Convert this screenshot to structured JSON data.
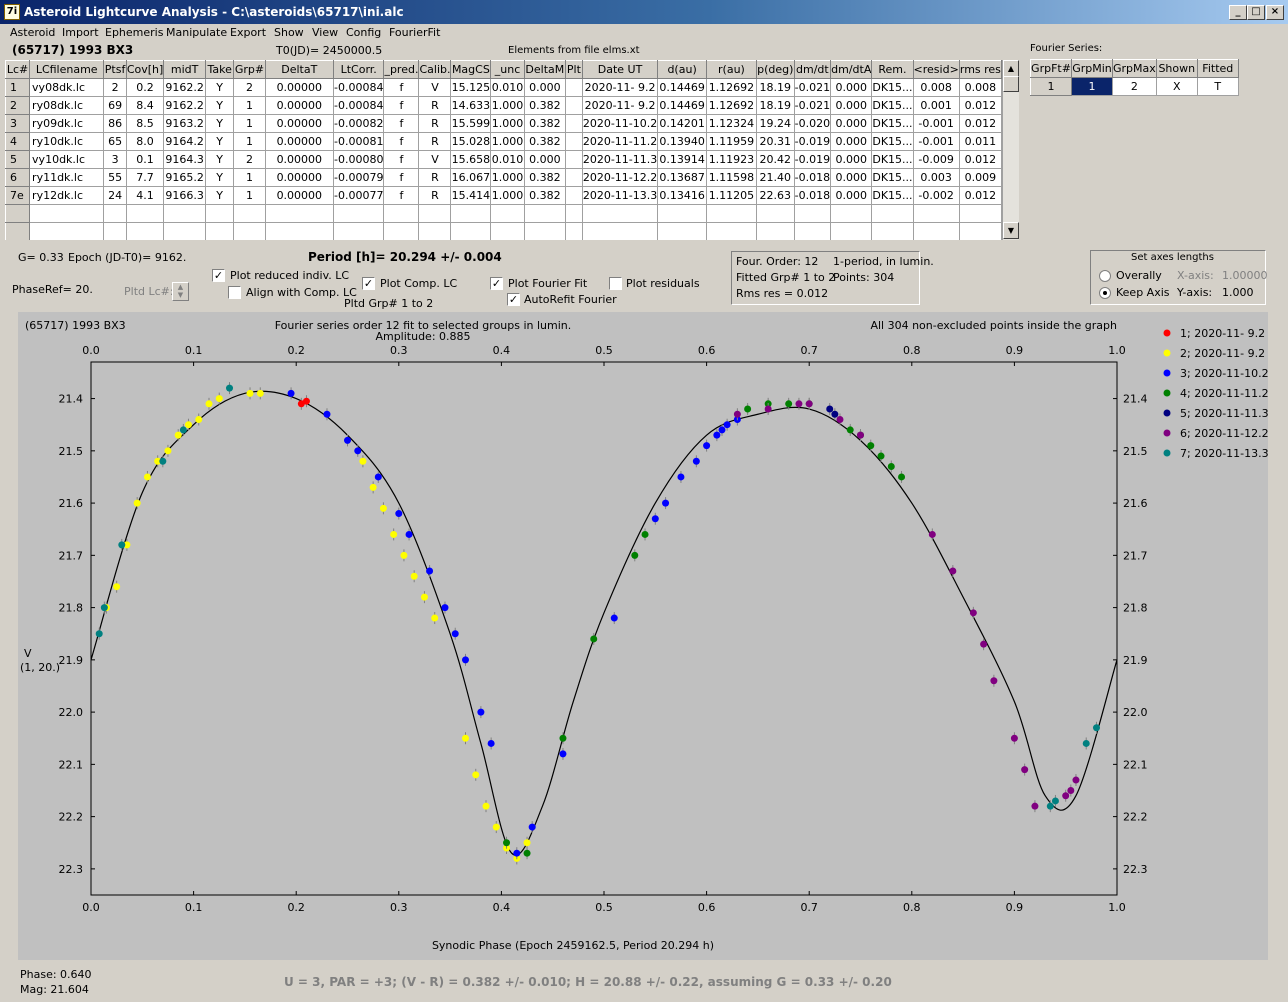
{
  "window": {
    "title": "Asteroid Lightcurve Analysis - C:\\asteroids\\65717\\ini.alc",
    "app_icon_label": "7i"
  },
  "menu": [
    "Asteroid",
    "Import",
    "Ephemeris",
    "Manipulate",
    "Export",
    "Show",
    "View",
    "Config",
    "FourierFit"
  ],
  "header": {
    "asteroid": "(65717) 1993 BX3",
    "t0": "T0(JD)= 2450000.5",
    "elements": "Elements from file elms.xt",
    "fourier_series_label": "Fourier Series:"
  },
  "table": {
    "columns": [
      "Lc#",
      "LCfilename",
      "Ptsf",
      "Cov[h]",
      "midT",
      "Take",
      "Grp#",
      "DeltaT",
      "LtCorr.",
      "_pred.",
      "Calib.",
      "MagCS",
      "_unc",
      "DeltaM",
      "Plt",
      "Date UT",
      "d(au)",
      "r(au)",
      "p(deg)",
      "dm/dt",
      "dm/dtA",
      "Rem.",
      "<resid>",
      "rms res"
    ],
    "rows": [
      [
        "1",
        "vy08dk.lc",
        "2",
        "0.2",
        "9162.2",
        "Y",
        "2",
        "0.00000",
        "-0.00084",
        "f",
        "V",
        "15.125",
        "0.010",
        "0.000",
        "",
        "2020-11- 9.2",
        "0.14469",
        "1.12692",
        "18.19",
        "-0.021",
        "0.000",
        "DK15...",
        "0.008",
        "0.008"
      ],
      [
        "2",
        "ry08dk.lc",
        "69",
        "8.4",
        "9162.2",
        "Y",
        "1",
        "0.00000",
        "-0.00084",
        "f",
        "R",
        "14.633",
        "1.000",
        "0.382",
        "",
        "2020-11- 9.2",
        "0.14469",
        "1.12692",
        "18.19",
        "-0.021",
        "0.000",
        "DK15...",
        "0.001",
        "0.012"
      ],
      [
        "3",
        "ry09dk.lc",
        "86",
        "8.5",
        "9163.2",
        "Y",
        "1",
        "0.00000",
        "-0.00082",
        "f",
        "R",
        "15.599",
        "1.000",
        "0.382",
        "",
        "2020-11-10.2",
        "0.14201",
        "1.12324",
        "19.24",
        "-0.020",
        "0.000",
        "DK15...",
        "-0.001",
        "0.012"
      ],
      [
        "4",
        "ry10dk.lc",
        "65",
        "8.0",
        "9164.2",
        "Y",
        "1",
        "0.00000",
        "-0.00081",
        "f",
        "R",
        "15.028",
        "1.000",
        "0.382",
        "",
        "2020-11-11.2",
        "0.13940",
        "1.11959",
        "20.31",
        "-0.019",
        "0.000",
        "DK15...",
        "-0.001",
        "0.011"
      ],
      [
        "5",
        "vy10dk.lc",
        "3",
        "0.1",
        "9164.3",
        "Y",
        "2",
        "0.00000",
        "-0.00080",
        "f",
        "V",
        "15.658",
        "0.010",
        "0.000",
        "",
        "2020-11-11.3",
        "0.13914",
        "1.11923",
        "20.42",
        "-0.019",
        "0.000",
        "DK15...",
        "-0.009",
        "0.012"
      ],
      [
        "6",
        "ry11dk.lc",
        "55",
        "7.7",
        "9165.2",
        "Y",
        "1",
        "0.00000",
        "-0.00079",
        "f",
        "R",
        "16.067",
        "1.000",
        "0.382",
        "",
        "2020-11-12.2",
        "0.13687",
        "1.11598",
        "21.40",
        "-0.018",
        "0.000",
        "DK15...",
        "0.003",
        "0.009"
      ],
      [
        "7e",
        "ry12dk.lc",
        "24",
        "4.1",
        "9166.3",
        "Y",
        "1",
        "0.00000",
        "-0.00077",
        "f",
        "R",
        "15.414",
        "1.000",
        "0.382",
        "",
        "2020-11-13.3",
        "0.13416",
        "1.11205",
        "22.63",
        "-0.018",
        "0.000",
        "DK15...",
        "-0.002",
        "0.012"
      ]
    ]
  },
  "fourier_table": {
    "columns": [
      "GrpFt#",
      "GrpMin",
      "GrpMax",
      "Shown",
      "Fitted"
    ],
    "row": [
      "1",
      "1",
      "2",
      "X",
      "T"
    ]
  },
  "info": {
    "g": "G= 0.33",
    "epoch": "Epoch (JD-T0)= 9162.",
    "period": "Period [h]= 20.294 +/- 0.004",
    "phaseref": "PhaseRef= 20.",
    "pltd_lc": "Pltd Lc#:",
    "pltd_grp": "Pltd Grp#  1   to   2",
    "four_order": "Four. Order: 12",
    "one_period": "1-period, in lumin.",
    "fitted_grp": "Fitted Grp# 1 to 2",
    "points": "Points: 304",
    "rms": "Rms res    = 0.012"
  },
  "checkboxes": [
    {
      "label": "Plot reduced indiv. LC",
      "checked": true
    },
    {
      "label": "Align with Comp. LC",
      "checked": false
    },
    {
      "label": "Plot Comp. LC",
      "checked": true
    },
    {
      "label": "Plot Fourier Fit",
      "checked": true
    },
    {
      "label": "AutoRefit Fourier",
      "checked": true
    },
    {
      "label": "Plot residuals",
      "checked": false
    }
  ],
  "axes_box": {
    "title": "Set axes lengths",
    "overally": "Overally",
    "keep_axis": "Keep Axis",
    "x_label": "X-axis:",
    "x_value": "1.00000",
    "y_label": "Y-axis:",
    "y_value": "1.000",
    "selected": "Keep Axis"
  },
  "status": {
    "phase": "Phase:  0.640",
    "mag": "Mag:    21.604",
    "summary": "U = 3, PAR = +3; (V - R) = 0.382 +/- 0.010; H = 20.88 +/- 0.22, assuming G = 0.33 +/- 0.20"
  },
  "chart_data": {
    "type": "scatter",
    "title": "(65717) 1993 BX3",
    "subtitle": "Fourier series order 12 fit to selected groups in lumin.",
    "amplitude": "Amplitude: 0.885",
    "note": "All 304 non-excluded points inside the graph",
    "xlabel": "Synodic Phase (Epoch 2459162.5, Period 20.294 h)",
    "ylabel": "V",
    "ylabel2": "(1, 20.)",
    "xlim": [
      0,
      1
    ],
    "ylim": [
      22.35,
      21.33
    ],
    "y_inverted": true,
    "xticks": [
      "0.0",
      "0.1",
      "0.2",
      "0.3",
      "0.4",
      "0.5",
      "0.6",
      "0.7",
      "0.8",
      "0.9",
      "1.0"
    ],
    "yticks": [
      "21.4",
      "21.5",
      "21.6",
      "21.7",
      "21.8",
      "21.9",
      "22.0",
      "22.1",
      "22.2",
      "22.3"
    ],
    "fit_curve": {
      "x": [
        0,
        0.05,
        0.1,
        0.15,
        0.2,
        0.25,
        0.3,
        0.35,
        0.38,
        0.41,
        0.44,
        0.47,
        0.5,
        0.55,
        0.6,
        0.65,
        0.7,
        0.75,
        0.8,
        0.85,
        0.9,
        0.93,
        0.96,
        1.0
      ],
      "y": [
        21.9,
        21.58,
        21.45,
        21.39,
        21.4,
        21.47,
        21.6,
        21.85,
        22.06,
        22.27,
        22.18,
        21.98,
        21.81,
        21.6,
        21.47,
        21.43,
        21.42,
        21.48,
        21.6,
        21.78,
        21.98,
        22.16,
        22.16,
        21.9
      ]
    },
    "series": [
      {
        "name": "1; 2020-11- 9.2",
        "color": "#ff0000",
        "x": [
          0.205,
          0.21
        ],
        "y": [
          21.41,
          21.405
        ]
      },
      {
        "name": "2; 2020-11- 9.2",
        "color": "#ffff00",
        "x": [
          0.015,
          0.025,
          0.035,
          0.045,
          0.055,
          0.065,
          0.075,
          0.085,
          0.095,
          0.105,
          0.115,
          0.125,
          0.155,
          0.165,
          0.265,
          0.275,
          0.285,
          0.295,
          0.305,
          0.315,
          0.325,
          0.335,
          0.365,
          0.375,
          0.385,
          0.395,
          0.405,
          0.415,
          0.425
        ],
        "y": [
          21.8,
          21.76,
          21.68,
          21.6,
          21.55,
          21.52,
          21.5,
          21.47,
          21.45,
          21.44,
          21.41,
          21.4,
          21.39,
          21.39,
          21.52,
          21.57,
          21.61,
          21.66,
          21.7,
          21.74,
          21.78,
          21.82,
          22.05,
          22.12,
          22.18,
          22.22,
          22.26,
          22.28,
          22.25
        ]
      },
      {
        "name": "3; 2020-11-10.2",
        "color": "#0000ff",
        "x": [
          0.195,
          0.23,
          0.25,
          0.26,
          0.28,
          0.3,
          0.31,
          0.33,
          0.345,
          0.355,
          0.365,
          0.38,
          0.39,
          0.415,
          0.43,
          0.46,
          0.51,
          0.55,
          0.56,
          0.575,
          0.59,
          0.6,
          0.61,
          0.615,
          0.62,
          0.63
        ],
        "y": [
          21.39,
          21.43,
          21.48,
          21.5,
          21.55,
          21.62,
          21.66,
          21.73,
          21.8,
          21.85,
          21.9,
          22.0,
          22.06,
          22.27,
          22.22,
          22.08,
          21.82,
          21.63,
          21.6,
          21.55,
          21.52,
          21.49,
          21.47,
          21.46,
          21.45,
          21.44
        ]
      },
      {
        "name": "4; 2020-11-11.2",
        "color": "#008000",
        "x": [
          0.405,
          0.425,
          0.46,
          0.49,
          0.53,
          0.54,
          0.64,
          0.66,
          0.68,
          0.7,
          0.74,
          0.75,
          0.76,
          0.77,
          0.78,
          0.79
        ],
        "y": [
          22.25,
          22.27,
          22.05,
          21.86,
          21.7,
          21.66,
          21.42,
          21.41,
          21.41,
          21.41,
          21.46,
          21.47,
          21.49,
          21.51,
          21.53,
          21.55
        ]
      },
      {
        "name": "5; 2020-11-11.3",
        "color": "#000080",
        "x": [
          0.72,
          0.725
        ],
        "y": [
          21.42,
          21.43
        ]
      },
      {
        "name": "6; 2020-11-12.2",
        "color": "#800080",
        "x": [
          0.63,
          0.66,
          0.69,
          0.7,
          0.73,
          0.75,
          0.82,
          0.84,
          0.86,
          0.87,
          0.88,
          0.9,
          0.91,
          0.92,
          0.95,
          0.955,
          0.96
        ],
        "y": [
          21.43,
          21.42,
          21.41,
          21.41,
          21.44,
          21.47,
          21.66,
          21.73,
          21.81,
          21.87,
          21.94,
          22.05,
          22.11,
          22.18,
          22.16,
          22.15,
          22.13
        ]
      },
      {
        "name": "7; 2020-11-13.3",
        "color": "#008080",
        "x": [
          0.008,
          0.013,
          0.03,
          0.07,
          0.09,
          0.135,
          0.935,
          0.94,
          0.97,
          0.98
        ],
        "y": [
          21.85,
          21.8,
          21.68,
          21.52,
          21.46,
          21.38,
          22.18,
          22.17,
          22.06,
          22.03
        ]
      }
    ]
  }
}
